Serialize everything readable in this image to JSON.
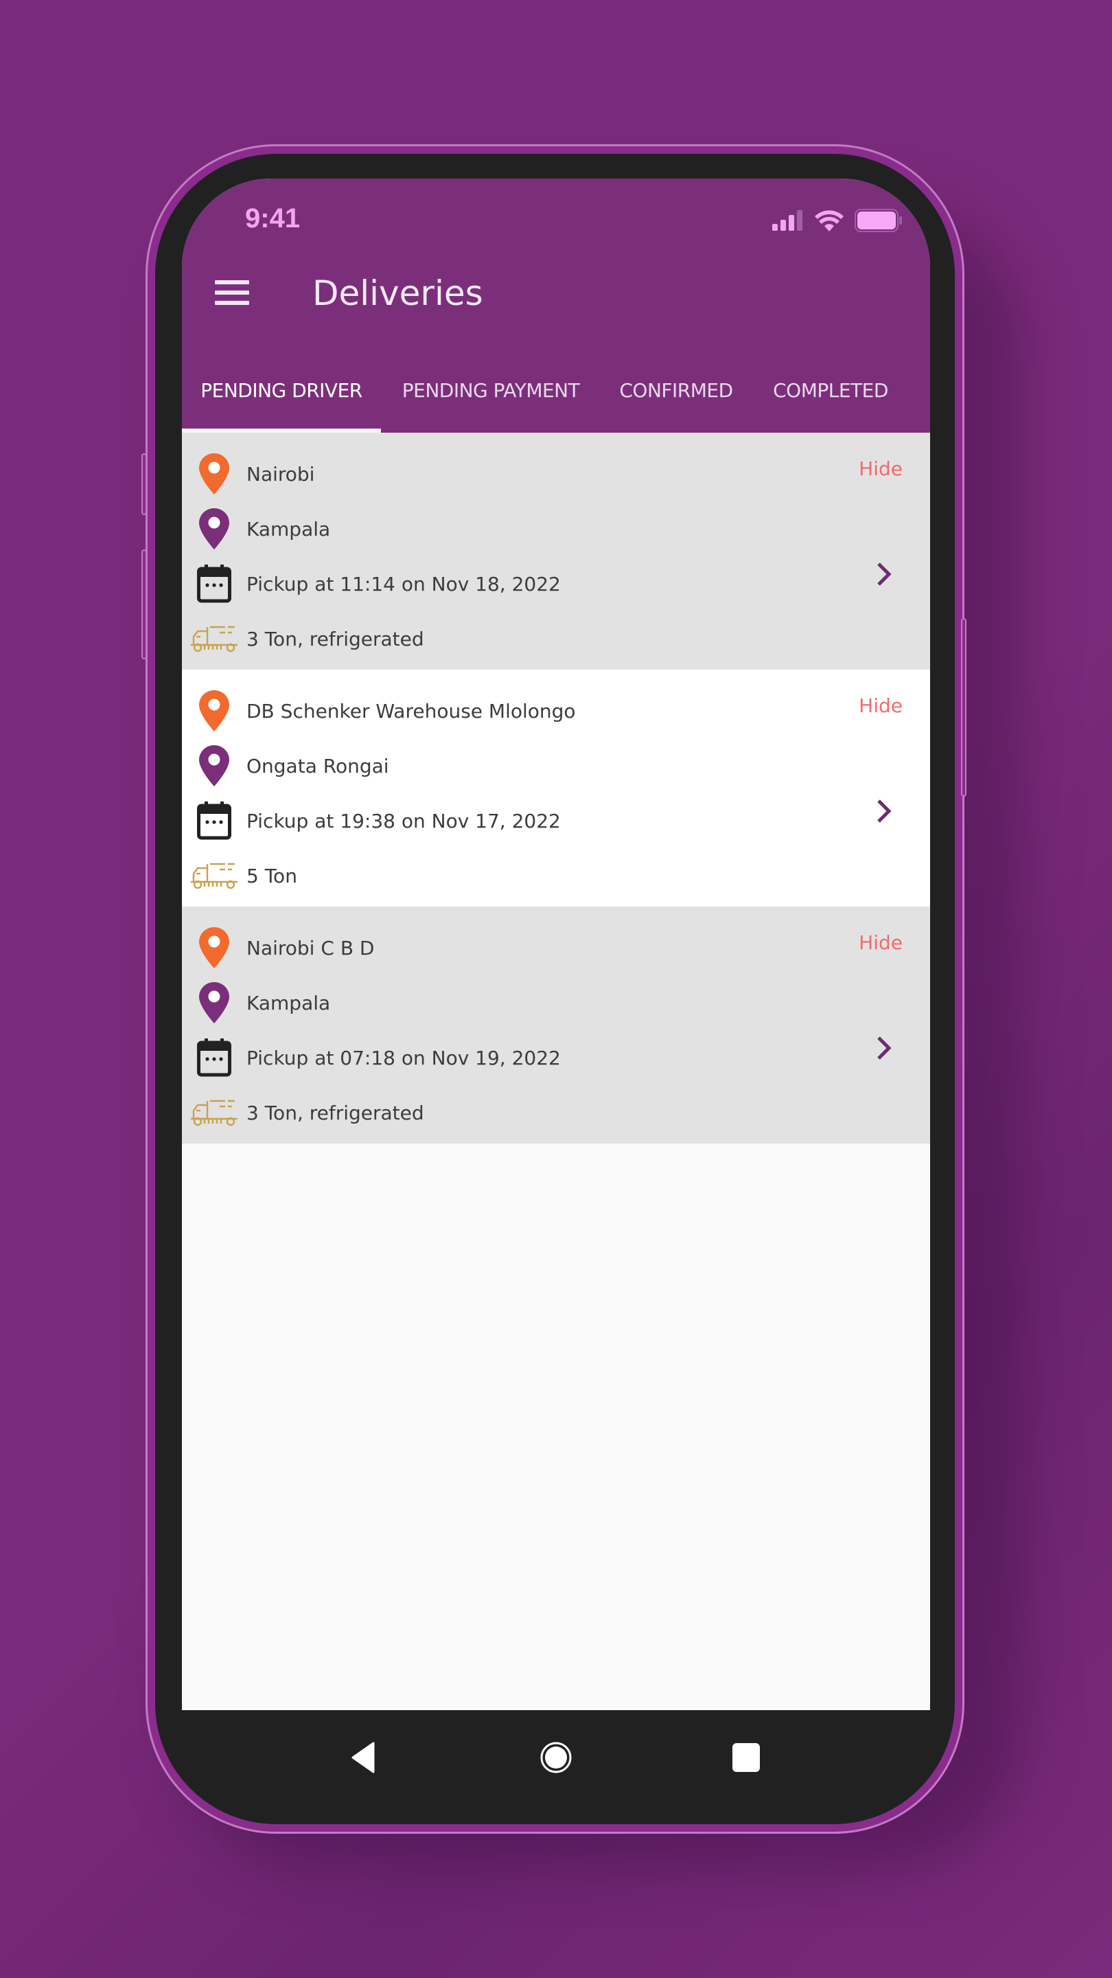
{
  "status_bar": {
    "time": "9:41"
  },
  "app_bar": {
    "title": "Deliveries",
    "menu_icon": "hamburger-menu-icon"
  },
  "tabs": [
    {
      "label": "PENDING DRIVER",
      "active": true
    },
    {
      "label": "PENDING PAYMENT",
      "active": false
    },
    {
      "label": "CONFIRMED",
      "active": false
    },
    {
      "label": "COMPLETED",
      "active": false
    }
  ],
  "colors": {
    "brand_purple": "#7b2f7b",
    "origin_pin": "#f26a2e",
    "destination_pin": "#7b2f7b",
    "hide_text": "#f26b6b",
    "truck_icon": "#c9a24e"
  },
  "deliveries": [
    {
      "origin": "Nairobi",
      "destination": "Kampala",
      "pickup": "Pickup at 11:14 on Nov 18, 2022",
      "vehicle": "3 Ton, refrigerated",
      "hide_label": "Hide"
    },
    {
      "origin": "DB Schenker Warehouse Mlolongo",
      "destination": "Ongata Rongai",
      "pickup": "Pickup at 19:38 on Nov 17, 2022",
      "vehicle": "5 Ton",
      "hide_label": "Hide"
    },
    {
      "origin": "Nairobi C B D",
      "destination": "Kampala",
      "pickup": "Pickup at 07:18 on Nov 19, 2022",
      "vehicle": "3 Ton, refrigerated",
      "hide_label": "Hide"
    }
  ],
  "nav_bar": {
    "back": "back-icon",
    "home": "home-icon",
    "recents": "recents-icon"
  }
}
